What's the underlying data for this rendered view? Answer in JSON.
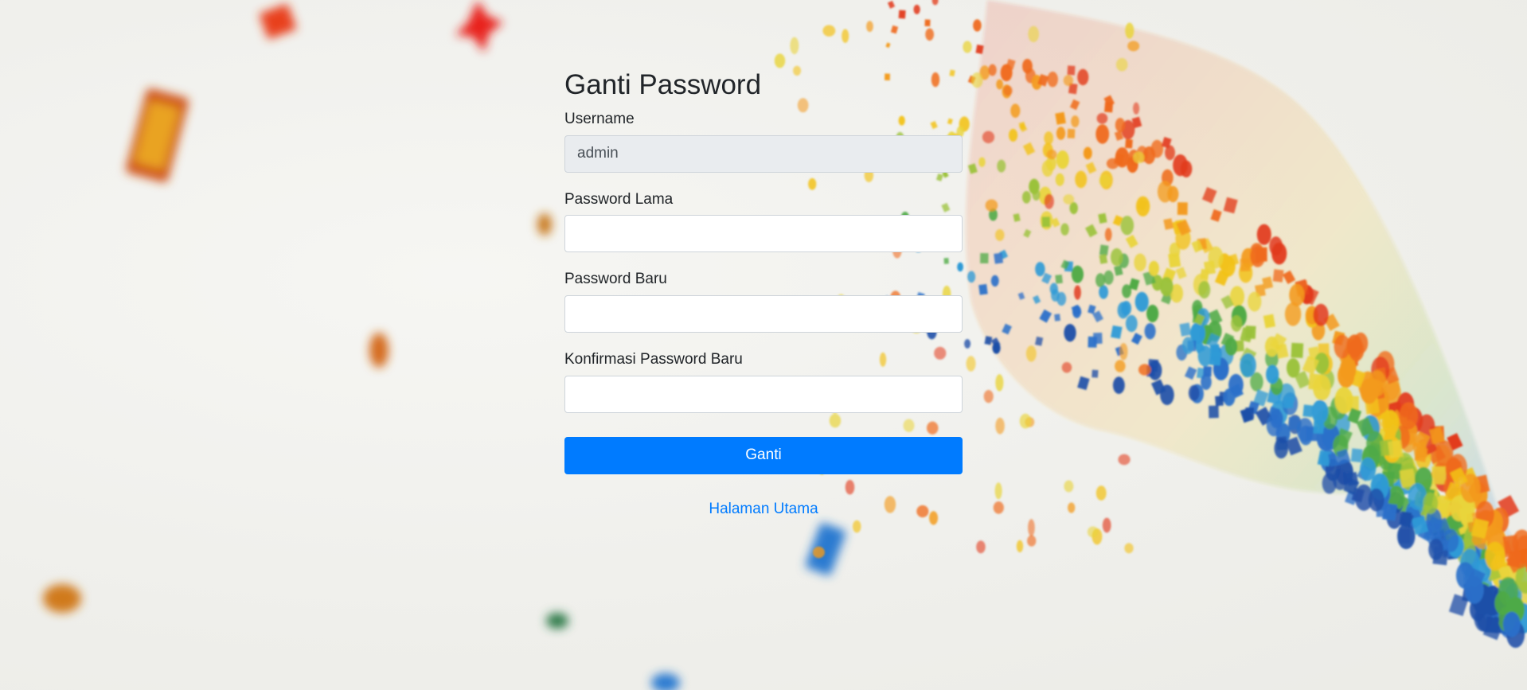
{
  "page": {
    "title": "Ganti Password"
  },
  "form": {
    "username": {
      "label": "Username",
      "value": "admin"
    },
    "old_password": {
      "label": "Password Lama",
      "value": ""
    },
    "new_password": {
      "label": "Password Baru",
      "value": ""
    },
    "confirm_password": {
      "label": "Konfirmasi Password Baru",
      "value": ""
    },
    "submit_label": "Ganti",
    "home_link": "Halaman Utama"
  },
  "colors": {
    "accent": "#007bff",
    "readonly_bg": "#e9ecef",
    "background": "#f1f1ee"
  }
}
